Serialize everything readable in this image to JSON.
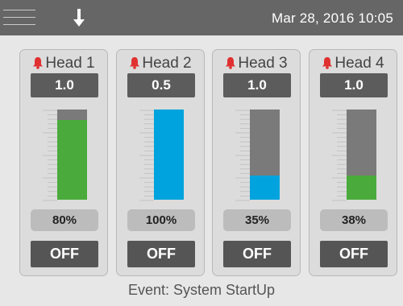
{
  "header": {
    "datetime": "Mar 28, 2016 10:05",
    "menu_icon": "hamburger-menu-icon",
    "action_icon": "arrow-down-icon"
  },
  "colors": {
    "header_bg": "#666666",
    "alarm_red": "#e03030",
    "bar_track": "#7a7a7a",
    "bar_green": "#4aab3c",
    "bar_blue": "#00a3dd",
    "value_box": "#5c5c5c",
    "off_button": "#555555"
  },
  "heads": [
    {
      "label": "Head 1",
      "value": "1.0",
      "percent_label": "80%",
      "fill_fraction": 0.88,
      "fill_color": "#4aab3c",
      "button": "OFF",
      "alarm_icon": "bell-icon"
    },
    {
      "label": "Head 2",
      "value": "0.5",
      "percent_label": "100%",
      "fill_fraction": 1.0,
      "fill_color": "#00a3dd",
      "button": "OFF",
      "alarm_icon": "bell-icon"
    },
    {
      "label": "Head 3",
      "value": "1.0",
      "percent_label": "35%",
      "fill_fraction": 0.27,
      "fill_color": "#00a3dd",
      "button": "OFF",
      "alarm_icon": "bell-icon"
    },
    {
      "label": "Head 4",
      "value": "1.0",
      "percent_label": "38%",
      "fill_fraction": 0.27,
      "fill_color": "#4aab3c",
      "button": "OFF",
      "alarm_icon": "bell-icon"
    }
  ],
  "footer": {
    "event": "Event: System StartUp"
  }
}
